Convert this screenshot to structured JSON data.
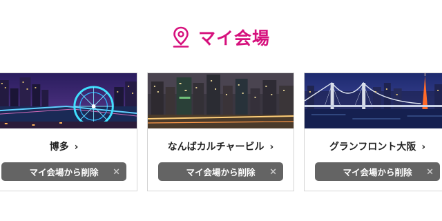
{
  "header": {
    "icon": "map-pin-icon",
    "title": "マイ会場",
    "accent_color": "#d6117d"
  },
  "venues": [
    {
      "name": "博多",
      "chevron": "›",
      "remove_label": "マイ会場から削除",
      "remove_icon": "×",
      "image": "night-city-ferris-wheel"
    },
    {
      "name": "なんばカルチャービル",
      "chevron": "›",
      "remove_label": "マイ会場から削除",
      "remove_icon": "×",
      "image": "night-city-skyline"
    },
    {
      "name": "グランフロント大阪",
      "chevron": "›",
      "remove_label": "マイ会場から削除",
      "remove_icon": "×",
      "image": "night-city-bridge-tower"
    }
  ],
  "button_color": "#646464"
}
